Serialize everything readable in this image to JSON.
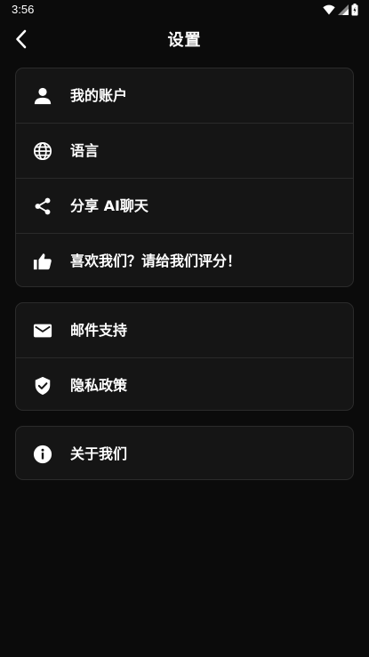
{
  "status_bar": {
    "time": "3:56"
  },
  "header": {
    "title": "设置"
  },
  "groups": [
    {
      "items": [
        {
          "label": "我的账户",
          "icon": "person-icon"
        },
        {
          "label": "语言",
          "icon": "globe-icon"
        },
        {
          "label": "分享 AI聊天",
          "icon": "share-icon"
        },
        {
          "label": "喜欢我们？请给我们评分！",
          "icon": "thumbs-up-icon"
        }
      ]
    },
    {
      "items": [
        {
          "label": "邮件支持",
          "icon": "mail-icon"
        },
        {
          "label": "隐私政策",
          "icon": "shield-check-icon"
        }
      ]
    },
    {
      "items": [
        {
          "label": "关于我们",
          "icon": "info-icon"
        }
      ]
    }
  ],
  "colors": {
    "background": "#0b0b0b",
    "card": "#151515",
    "text": "#ffffff"
  }
}
